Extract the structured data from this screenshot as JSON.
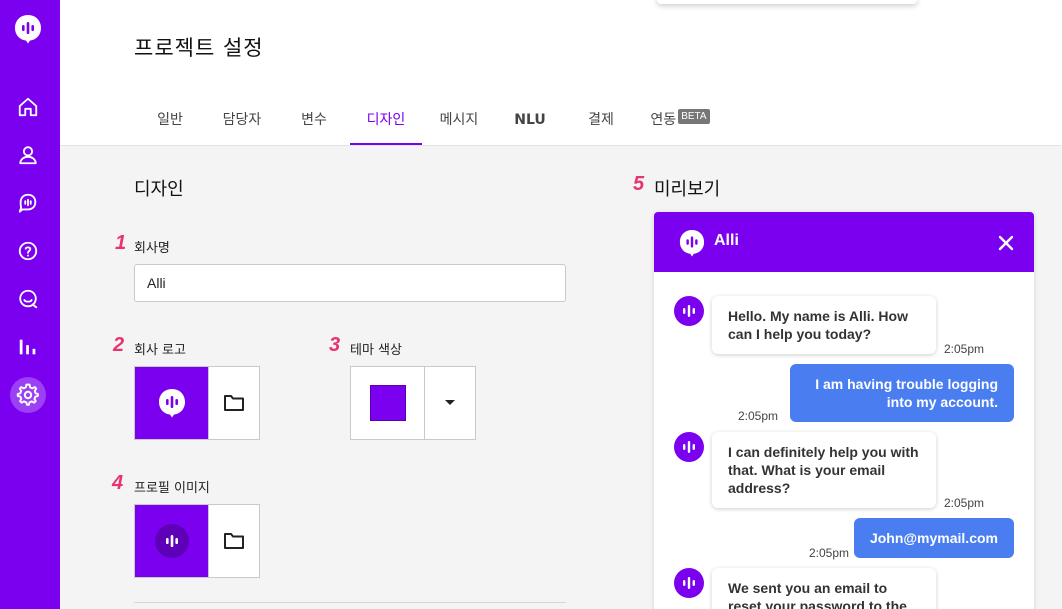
{
  "page": {
    "title": "프로젝트 설정"
  },
  "tabs": [
    {
      "label": "일반"
    },
    {
      "label": "담당자"
    },
    {
      "label": "변수"
    },
    {
      "label": "디자인",
      "active": true
    },
    {
      "label": "메시지"
    },
    {
      "label": "NLU"
    },
    {
      "label": "결제"
    },
    {
      "label": "연동",
      "badge": "BETA"
    }
  ],
  "sidebar": {
    "items": [
      {
        "icon": "home-icon"
      },
      {
        "icon": "user-icon"
      },
      {
        "icon": "chat-icon"
      },
      {
        "icon": "help-icon"
      },
      {
        "icon": "search-chat-icon"
      },
      {
        "icon": "bar-chart-icon"
      },
      {
        "icon": "gear-icon",
        "active": true
      }
    ]
  },
  "design": {
    "title": "디자인",
    "company_name_label": "회사명",
    "company_name_value": "Alli",
    "company_logo_label": "회사 로고",
    "theme_color_label": "테마 색상",
    "theme_color": "#7b00f0",
    "profile_image_label": "프로필 이미지",
    "markers": [
      "1",
      "2",
      "3",
      "4",
      "5"
    ]
  },
  "preview": {
    "title": "미리보기",
    "bot_name": "Alli",
    "messages": [
      {
        "from": "bot",
        "text": "Hello. My name is Alli. How can I help you today?",
        "time": "2:05pm"
      },
      {
        "from": "user",
        "text": "I am having trouble logging into my account.",
        "time": "2:05pm"
      },
      {
        "from": "bot",
        "text": "I can definitely help you with that. What is your email address?",
        "time": "2:05pm"
      },
      {
        "from": "user",
        "text": "John@mymail.com",
        "time": "2:05pm"
      },
      {
        "from": "bot",
        "text": "We sent you an email to reset your password to the",
        "time": ""
      }
    ]
  },
  "colors": {
    "accent": "#7b00f0",
    "user_bubble": "#4a7ef0",
    "marker": "#e8336d"
  }
}
